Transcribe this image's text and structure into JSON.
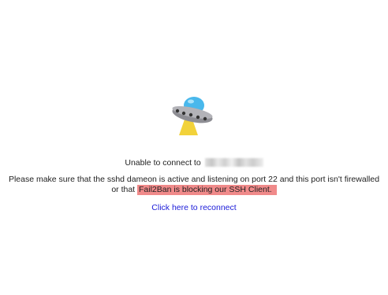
{
  "error": {
    "icon": "ufo-icon",
    "connect_prefix": "Unable to connect to",
    "line1": "Please make sure that the sshd dameon is active and listening on port 22 and this port isn't firewalled",
    "line2_prefix": "or that ",
    "line2_highlight": "Fail2Ban is blocking our SSH Client.",
    "reconnect_link": "Click here to reconnect",
    "highlight_color": "#f08a8a",
    "link_color": "#1a1ad8"
  }
}
